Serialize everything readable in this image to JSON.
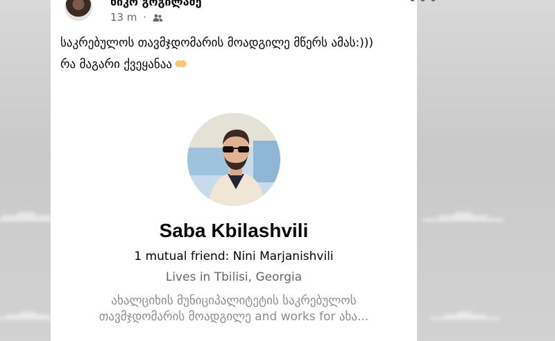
{
  "post": {
    "author": "ნიკო გოგილაძე",
    "time": "13 m",
    "separator": "·",
    "privacy_icon": "friends-icon",
    "more_icon": "ellipsis-icon",
    "text_line1": "საკრებულოს თავმჯდომარის მოადგილე მწერს ამას:)))",
    "text_line2": "რა მაგარი ქვეყანაა"
  },
  "profile": {
    "name": "Saba Kbilashvili",
    "mutual": "1 mutual friend: Nini Marjanishvili",
    "lives": "Lives in Tbilisi, Georgia",
    "bio": "ახალციხის მუნიციპალიტეტის საკრებულოს თავმჯდომარის მოადგილე and works for ახა..."
  },
  "colors": {
    "text": "#050505",
    "secondary": "#65676b",
    "card": "#ffffff"
  }
}
